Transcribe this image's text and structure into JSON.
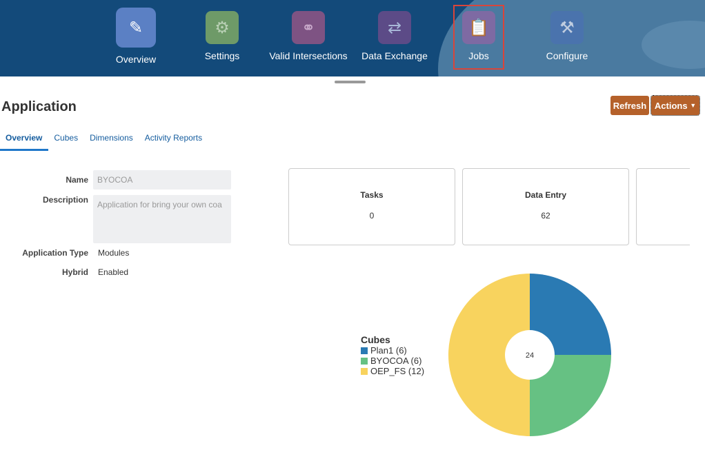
{
  "nav": [
    {
      "label": "Overview",
      "icon": "overview-icon",
      "color": "#5b80c4"
    },
    {
      "label": "Settings",
      "icon": "gears-icon",
      "color": "#6e9a68"
    },
    {
      "label": "Valid Intersections",
      "icon": "intersections-icon",
      "color": "#7e5383"
    },
    {
      "label": "Data Exchange",
      "icon": "exchange-arrows-icon",
      "color": "#5c4b87"
    },
    {
      "label": "Jobs",
      "icon": "clipboard-icon",
      "color": "#7e6aa3"
    },
    {
      "label": "Configure",
      "icon": "tools-icon",
      "color": "#4a73ad"
    }
  ],
  "page": {
    "title": "Application",
    "refresh": "Refresh",
    "actions": "Actions"
  },
  "tabs": [
    "Overview",
    "Cubes",
    "Dimensions",
    "Activity Reports"
  ],
  "form": {
    "name_label": "Name",
    "name_value": "BYOCOA",
    "description_label": "Description",
    "description_value": "Application for bring your own coa",
    "type_label": "Application Type",
    "type_value": "Modules",
    "hybrid_label": "Hybrid",
    "hybrid_value": "Enabled"
  },
  "cards": [
    {
      "title": "Tasks",
      "value": "0"
    },
    {
      "title": "Data Entry",
      "value": "62"
    }
  ],
  "chart_data": {
    "type": "pie",
    "legend_title": "Cubes",
    "legend_position": "left",
    "center_label": "24",
    "slices": [
      {
        "label": "Plan1 (6)",
        "name": "Plan1",
        "value": 6,
        "color": "#2a7ab3"
      },
      {
        "label": "BYOCOA (6)",
        "name": "BYOCOA",
        "value": 6,
        "color": "#66c183"
      },
      {
        "label": "OEP_FS (12)",
        "name": "OEP_FS",
        "value": 12,
        "color": "#f8d35e"
      }
    ]
  }
}
